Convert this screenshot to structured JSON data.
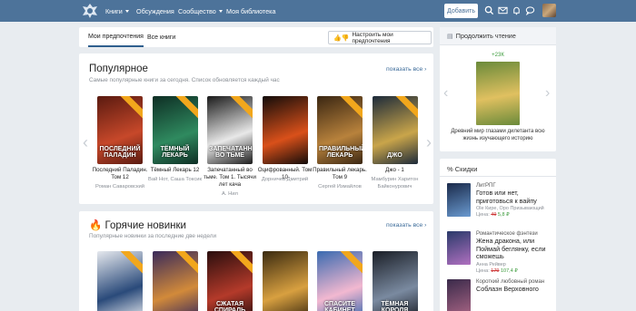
{
  "header": {
    "nav": [
      {
        "label": "Книги",
        "has_caret": true
      },
      {
        "label": "Обсуждения",
        "has_caret": false
      },
      {
        "label": "Сообщество",
        "has_caret": true
      },
      {
        "label": "Моя библиотека",
        "has_caret": false
      }
    ],
    "add_button": "Добавить",
    "icons": [
      "search-icon",
      "mail-icon",
      "bell-icon",
      "chat-icon"
    ]
  },
  "tabs": {
    "items": [
      "Мои предпочтения",
      "Все книги"
    ],
    "active": 0,
    "settings_button": "Настроить мои предпочтения"
  },
  "popular": {
    "title": "Популярное",
    "subtitle": "Самые популярные книги за сегодня. Список обновляется каждый час",
    "show_all": "показать все",
    "books": [
      {
        "cover_text": "ПОСЛЕДНИЙ ПАЛАДИН",
        "title": "Последний Паладин. Том 12",
        "author": "Роман Саваровский",
        "colors": [
          "#5a1a10",
          "#c7482a"
        ],
        "ribbon": true
      },
      {
        "cover_text": "ТЁМНЫЙ ЛЕКАРЬ",
        "title": "Тёмный Лекарь 12",
        "author": "Вай Нот, Саша Токсик",
        "colors": [
          "#0e2e24",
          "#2f8a5f"
        ],
        "ribbon": true
      },
      {
        "cover_text": "ЗАПЕЧАТАННЫЙ ВО ТЬМЕ",
        "title": "Запечатанный во тьме. Том 1. Тысячи лет кача",
        "author": "А. Нил",
        "colors": [
          "#1a1a1a",
          "#e8e8e8"
        ],
        "ribbon": true
      },
      {
        "cover_text": "",
        "title": "Оцифрованный. Том 10",
        "author": "Дорничев Дмитрий",
        "colors": [
          "#120c0a",
          "#d9501a"
        ],
        "ribbon": false
      },
      {
        "cover_text": "ПРАВИЛЬНЫЙ ЛЕКАРЬ",
        "title": "Правильный лекарь. Том 9",
        "author": "Сергей Измайлов",
        "colors": [
          "#3a2612",
          "#b8823c"
        ],
        "ribbon": true
      },
      {
        "cover_text": "ДЖО",
        "title": "Джо - 1",
        "author": "Мамбурин Харитон Байконурович",
        "colors": [
          "#1c2a3a",
          "#c9a54a"
        ],
        "ribbon": true
      }
    ]
  },
  "hot": {
    "title": "Горячие новинки",
    "subtitle": "Популярные новинки за последние две недели",
    "show_all": "показать все",
    "books": [
      {
        "cover_text": "",
        "colors": [
          "#e6e9ee",
          "#2a4a7a"
        ],
        "ribbon": true
      },
      {
        "cover_text": "",
        "colors": [
          "#3a2a5a",
          "#d28a3a"
        ],
        "ribbon": true
      },
      {
        "cover_text": "СЖАТАЯ СПИРАЛЬ",
        "colors": [
          "#2a0e0e",
          "#b43a2a"
        ],
        "ribbon": true
      },
      {
        "cover_text": "",
        "colors": [
          "#3a2a10",
          "#d8a040"
        ],
        "ribbon": false
      },
      {
        "cover_text": "СПАСИТЕ КАБИНЕТ",
        "colors": [
          "#3a6ab0",
          "#f2b8d0"
        ],
        "ribbon": true
      },
      {
        "cover_text": "ТЁМНАЯ КОРОЛЯ",
        "colors": [
          "#1a1e26",
          "#7a8aa0"
        ],
        "ribbon": false
      }
    ]
  },
  "continue_reading": {
    "title": "Продолжить чтение",
    "badge": "+23К",
    "book_title": "Древний мир глазами дилетанта всю жизнь изучающего историю",
    "colors": [
      "#6a8a3a",
      "#e0c060"
    ]
  },
  "discounts": {
    "title": "% Скидки",
    "items": [
      {
        "genre": "ЛитРПГ",
        "title": "Готов или нет, приготовься к вайпу",
        "author": "Ole Кире, Оро Призывающий",
        "price_label": "Цена:",
        "old_price": "49",
        "new_price": "5,8 ₽",
        "colors": [
          "#1a2a4a",
          "#6a9ad0"
        ]
      },
      {
        "genre": "Романтическое фэнтези",
        "title": "Жена дракона, или Поймай беглянку, если сможешь",
        "author": "Анна Рейвер",
        "price_label": "Цена:",
        "old_price": "179",
        "new_price": "107,4 ₽",
        "colors": [
          "#2a3a6a",
          "#b070c0"
        ]
      },
      {
        "genre": "Короткий любовный роман",
        "title": "Соблазн Верховного",
        "author": "",
        "price_label": "",
        "old_price": "",
        "new_price": "",
        "colors": [
          "#3a2a4a",
          "#a06080"
        ]
      }
    ]
  }
}
